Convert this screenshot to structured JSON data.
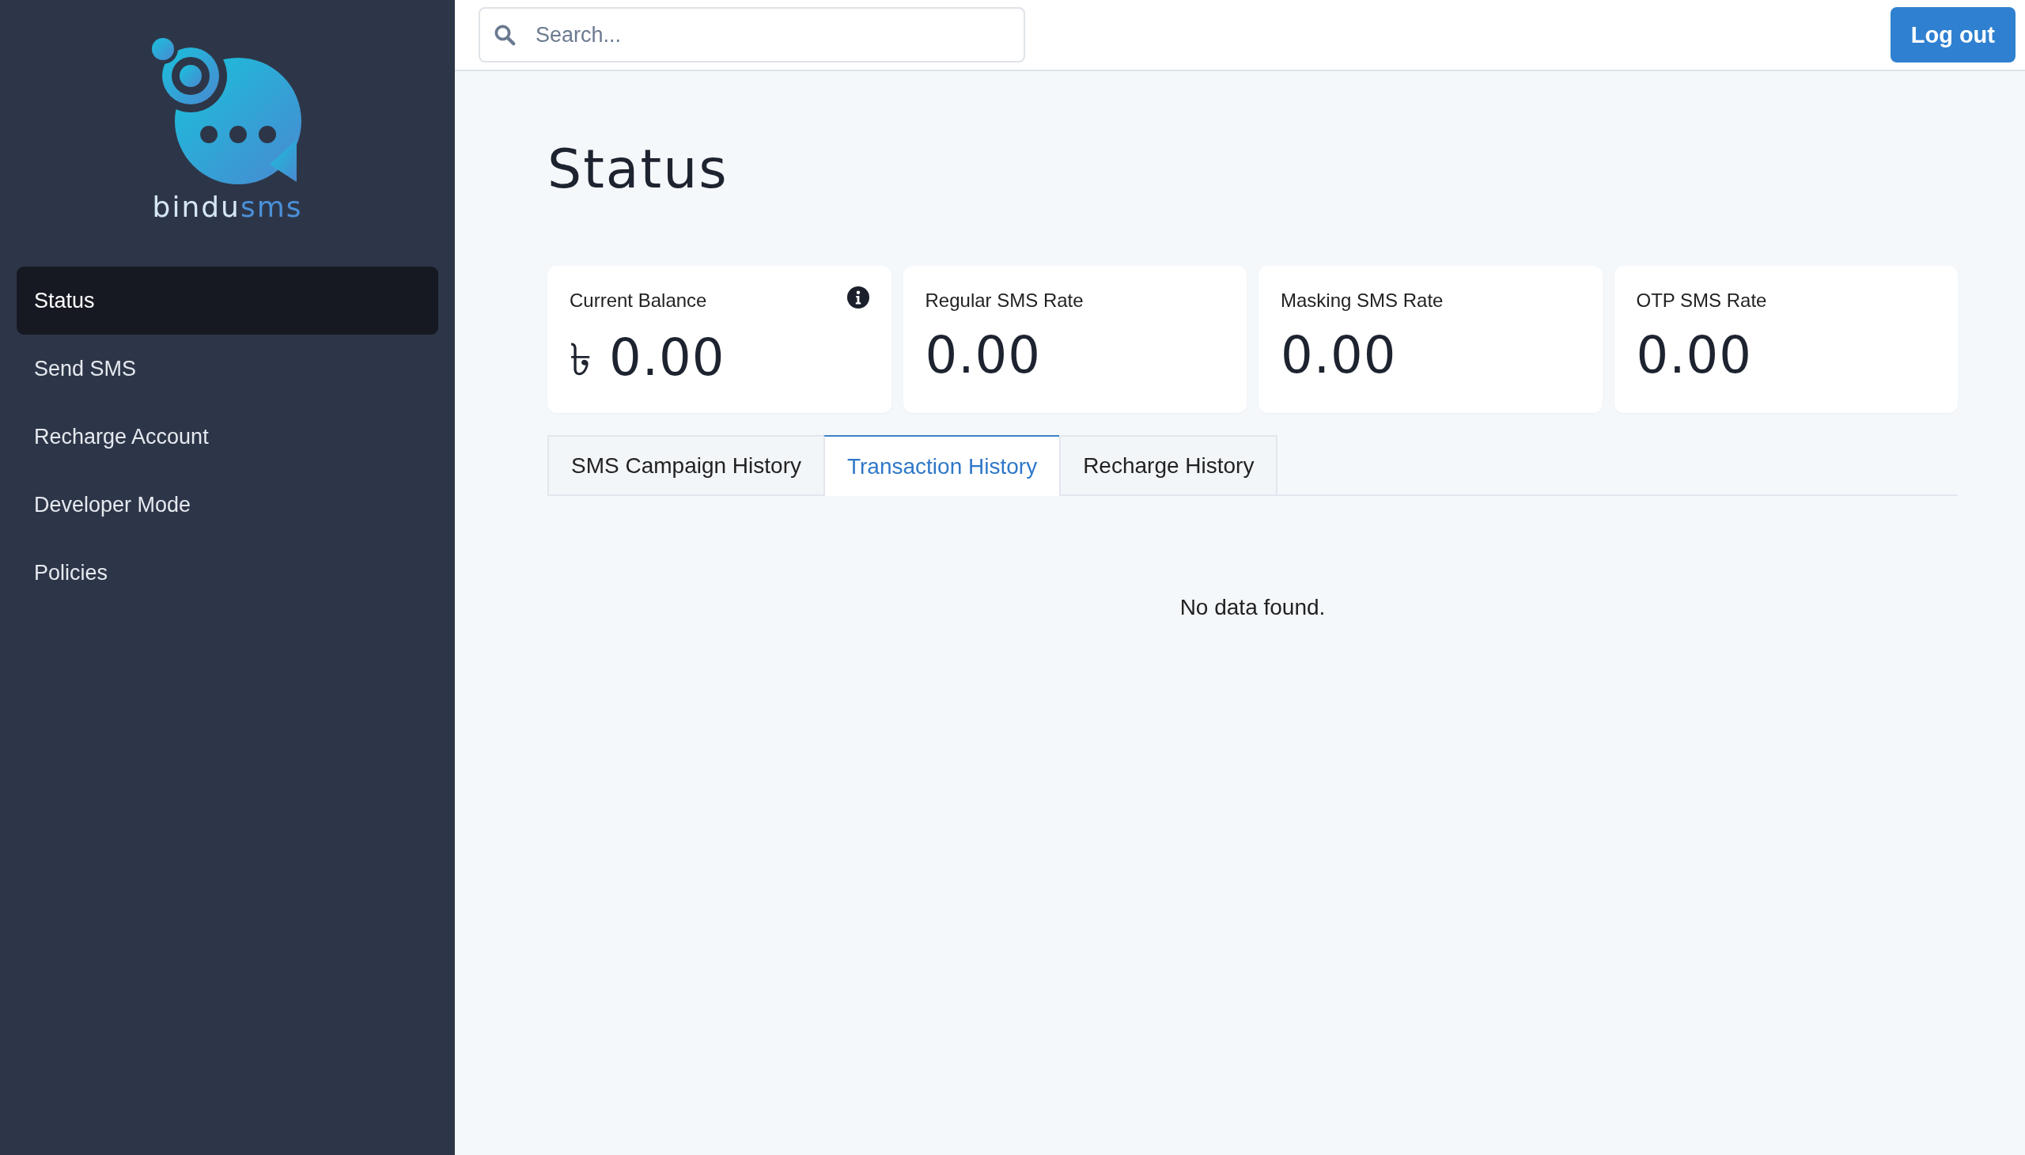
{
  "sidebar": {
    "logo": {
      "name_parts": [
        "bindu",
        "sms"
      ]
    },
    "items": [
      {
        "label": "Status",
        "selected": true
      },
      {
        "label": "Send SMS",
        "selected": false
      },
      {
        "label": "Recharge Account",
        "selected": false
      },
      {
        "label": "Developer Mode",
        "selected": false
      },
      {
        "label": "Policies",
        "selected": false
      }
    ]
  },
  "topbar": {
    "search": {
      "placeholder": "Search..."
    },
    "logout_button": "Log out"
  },
  "page_title": "Status",
  "cards": [
    {
      "label": "Current Balance",
      "currency": "৳",
      "value": "0.00",
      "info": true
    },
    {
      "label": "Regular SMS Rate",
      "value": "0.00",
      "info": false
    },
    {
      "label": "Masking SMS Rate",
      "value": "0.00",
      "info": false
    },
    {
      "label": "OTP SMS Rate",
      "value": "0.00",
      "info": false
    }
  ],
  "tabs": [
    {
      "label": "SMS Campaign History",
      "selected": false
    },
    {
      "label": "Transaction History",
      "selected": true
    },
    {
      "label": "Recharge History",
      "selected": false
    }
  ],
  "empty_message": "No data found."
}
